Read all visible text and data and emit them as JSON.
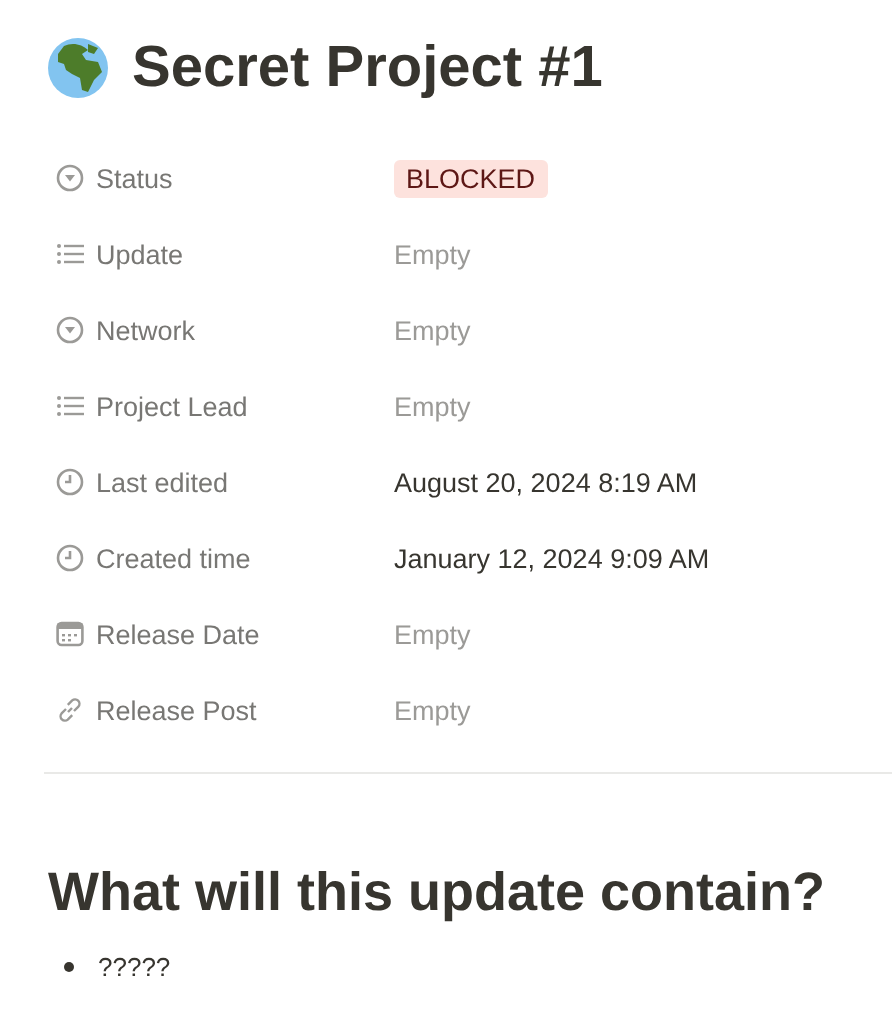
{
  "page": {
    "title": "Secret Project #1"
  },
  "properties": [
    {
      "kind": "select",
      "label": "Status",
      "value": "BLOCKED",
      "empty": false,
      "color": "#fde2dd"
    },
    {
      "kind": "multi_select",
      "label": "Update",
      "value": "Empty",
      "empty": true
    },
    {
      "kind": "select",
      "label": "Network",
      "value": "Empty",
      "empty": true
    },
    {
      "kind": "multi_select",
      "label": "Project Lead",
      "value": "Empty",
      "empty": true
    },
    {
      "kind": "last_edited_time",
      "label": "Last edited",
      "value": "August 20, 2024 8:19 AM",
      "empty": false
    },
    {
      "kind": "created_time",
      "label": "Created time",
      "value": "January 12, 2024 9:09 AM",
      "empty": false
    },
    {
      "kind": "date",
      "label": "Release Date",
      "value": "Empty",
      "empty": true
    },
    {
      "kind": "url",
      "label": "Release Post",
      "value": "Empty",
      "empty": true
    }
  ],
  "content": {
    "heading": "What will this update contain?",
    "bullets": [
      "?????"
    ]
  }
}
